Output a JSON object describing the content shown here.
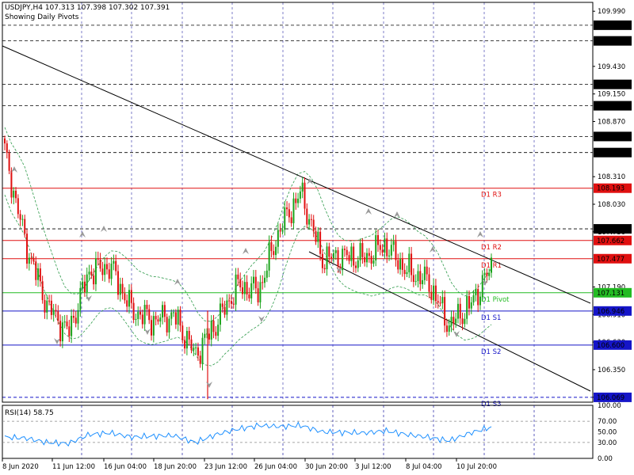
{
  "header": {
    "symbol_line": "USDJPY,H4  107.313 107.398 107.302 107.391",
    "subtitle": "Showing Daily Pivots"
  },
  "colors": {
    "up": "#1aa31a",
    "down": "#e01010",
    "resistance": "#e01010",
    "pivot": "#22bb22",
    "support": "#1515c8",
    "envelope": "#2e9a4a",
    "trendline": "#000000",
    "grid": "#1a1aa0",
    "rsi": "#1e90ff",
    "fractal": "#9a9a9a"
  },
  "chart_data": [
    {
      "type": "candlestick",
      "symbol": "USDJPY",
      "timeframe": "H4",
      "ylim": [
        106.02,
        110.08
      ],
      "y_ticks": [
        109.99,
        109.43,
        109.15,
        108.87,
        108.31,
        108.03,
        107.75,
        107.19,
        106.91,
        106.63,
        106.35,
        106.07
      ],
      "x_ticks": [
        "8 Jun 2020",
        "11 Jun 12:00",
        "16 Jun 04:00",
        "18 Jun 20:00",
        "23 Jun 12:00",
        "26 Jun 04:00",
        "30 Jun 20:00",
        "3 Jul 12:00",
        "8 Jul 04:00",
        "10 Jul 20:00"
      ],
      "ohlc_anchors": [
        {
          "time": "8 Jun 2020",
          "close": 108.55
        },
        {
          "time": "9 Jun 12:00",
          "close": 107.62
        },
        {
          "time": "10 Jun 20:00",
          "close": 107.0
        },
        {
          "time": "11 Jun 08:00",
          "close": 106.72
        },
        {
          "time": "12 Jun 08:00",
          "close": 107.35
        },
        {
          "time": "15 Jun 20:00",
          "close": 107.4
        },
        {
          "time": "17 Jun 08:00",
          "close": 106.95
        },
        {
          "time": "18 Jun 20:00",
          "close": 106.85
        },
        {
          "time": "22 Jun 20:00",
          "close": 106.9
        },
        {
          "time": "23 Jun 04:00",
          "close": 106.5
        },
        {
          "time": "24 Jun 08:00",
          "close": 106.82
        },
        {
          "time": "25 Jun 08:00",
          "close": 107.2
        },
        {
          "time": "26 Jun 20:00",
          "close": 107.15
        },
        {
          "time": "29 Jun 08:00",
          "close": 107.78
        },
        {
          "time": "30 Jun 08:00",
          "close": 108.15
        },
        {
          "time": "1 Jul 04:00",
          "close": 107.48
        },
        {
          "time": "2 Jul 12:00",
          "close": 107.5
        },
        {
          "time": "3 Jul 08:00",
          "close": 107.48
        },
        {
          "time": "6 Jul 20:00",
          "close": 107.62
        },
        {
          "time": "7 Jul 12:00",
          "close": 107.35
        },
        {
          "time": "8 Jul 04:00",
          "close": 107.25
        },
        {
          "time": "9 Jul 16:00",
          "close": 106.8
        },
        {
          "time": "10 Jul 04:00",
          "close": 107.0
        },
        {
          "time": "13 Jul 04:00",
          "close": 107.39
        }
      ],
      "levels": [
        {
          "name": "D1 R3",
          "value": 108.193,
          "kind": "resistance"
        },
        {
          "name": "D1 R2",
          "value": 107.662,
          "kind": "resistance"
        },
        {
          "name": "D1 R1",
          "value": 107.477,
          "kind": "resistance"
        },
        {
          "name": "D1 Pivot",
          "value": 107.131,
          "kind": "pivot"
        },
        {
          "name": "D1 S1",
          "value": 106.946,
          "kind": "support"
        },
        {
          "name": "D1 S2",
          "value": 106.6,
          "kind": "support"
        },
        {
          "name": "D1 S3",
          "value": 106.069,
          "kind": "support"
        }
      ],
      "level_labels": [
        "D1 R3",
        "D1 R2",
        "D1 R1",
        "D1 Pivot",
        "D1 S1",
        "D1 S2",
        "D1 S3"
      ],
      "dashed_price_levels": [
        109.848,
        109.689,
        109.247,
        109.03,
        108.718,
        108.555,
        107.78
      ],
      "highlighted_price_labels": [
        "109.848",
        "109.689",
        "109.247",
        "109.030",
        "108.718",
        "108.555",
        "107.780",
        "108.193",
        "107.662",
        "107.477",
        "107.131",
        "106.946",
        "106.600",
        "106.069"
      ]
    },
    {
      "type": "line",
      "title": "RSI(14) 58.75",
      "ylim": [
        0,
        100
      ],
      "y_ticks": [
        "100.00",
        "70.00",
        "50.00",
        "30.00",
        "0.00"
      ],
      "levels": [
        70,
        30
      ],
      "x": [
        "8 Jun 2020",
        "9 Jun 12:00",
        "10 Jun 20:00",
        "11 Jun 08:00",
        "12 Jun 08:00",
        "15 Jun 20:00",
        "17 Jun 08:00",
        "18 Jun 20:00",
        "22 Jun 20:00",
        "23 Jun 04:00",
        "24 Jun 08:00",
        "25 Jun 08:00",
        "26 Jun 20:00",
        "29 Jun 08:00",
        "30 Jun 08:00",
        "1 Jul 04:00",
        "2 Jul 12:00",
        "3 Jul 08:00",
        "6 Jul 20:00",
        "7 Jul 12:00",
        "8 Jul 04:00",
        "9 Jul 16:00",
        "10 Jul 04:00",
        "13 Jul 04:00"
      ],
      "values": [
        40,
        38,
        30,
        28,
        45,
        48,
        40,
        42,
        43,
        30,
        45,
        55,
        62,
        60,
        62,
        50,
        49,
        48,
        52,
        45,
        40,
        33,
        48,
        58.75
      ]
    }
  ]
}
